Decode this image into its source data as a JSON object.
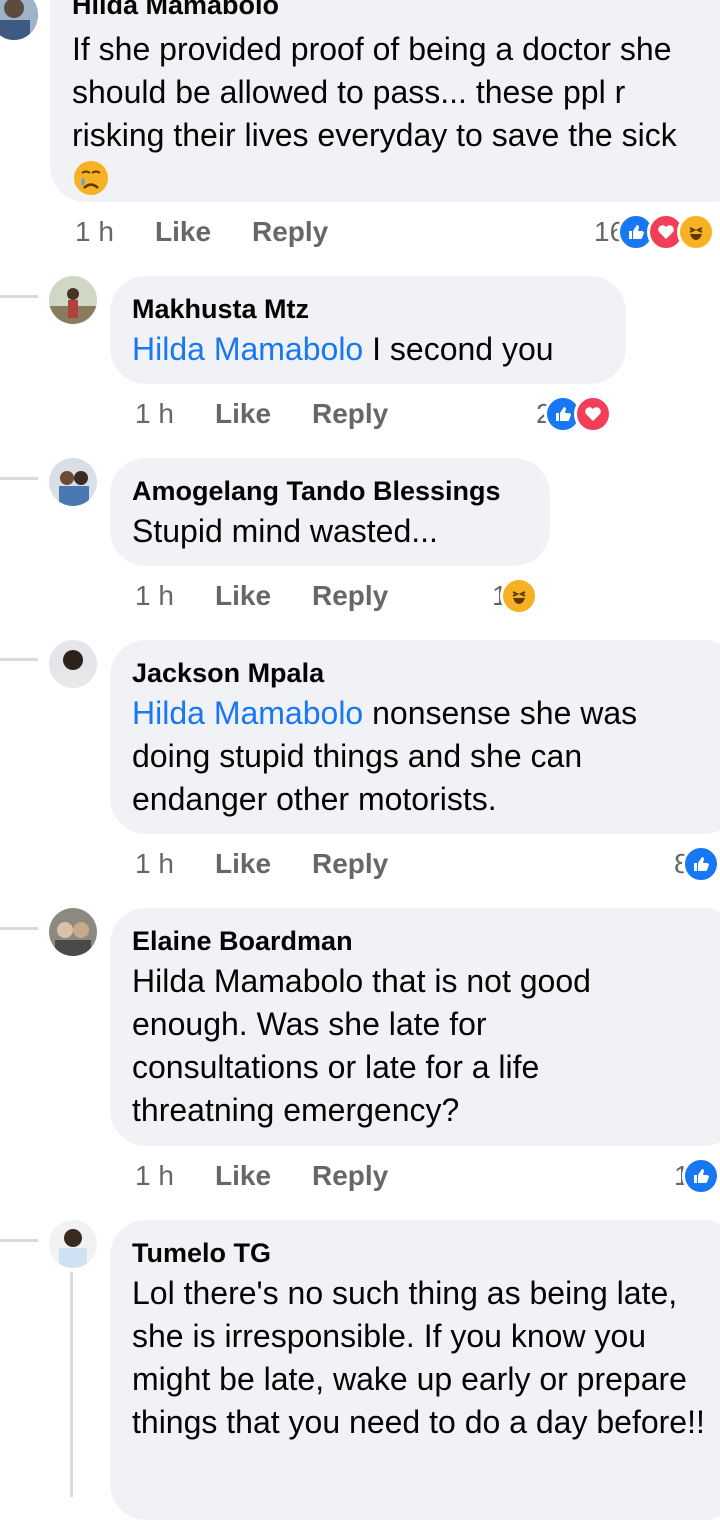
{
  "colors": {
    "link": "#1877f2",
    "bubble": "#f0f2f5",
    "meta": "#65676b",
    "like": "#1877f2",
    "love": "#f33e58",
    "haha": "#f7b125"
  },
  "top_comment": {
    "author": "Hilda Mamabolo",
    "text": "If she provided proof of being a doctor she should be allowed to pass... these ppl r risking their lives everyday to save the sick",
    "emoji": "crying-face-icon",
    "time": "1 h",
    "like": "Like",
    "reply": "Reply",
    "reaction_count": "16",
    "reactions": [
      "like-icon",
      "love-icon",
      "haha-icon"
    ]
  },
  "replies": [
    {
      "author": "Makhusta Mtz",
      "mention": "Hilda Mamabolo",
      "text": " I second you",
      "time": "1 h",
      "like": "Like",
      "reply": "Reply",
      "reaction_count": "2",
      "reactions": [
        "like-icon",
        "love-icon"
      ]
    },
    {
      "author": "Amogelang Tando Blessings",
      "mention": "",
      "text": "Stupid mind wasted...",
      "time": "1 h",
      "like": "Like",
      "reply": "Reply",
      "reaction_count": "1",
      "reactions": [
        "haha-icon"
      ]
    },
    {
      "author": "Jackson Mpala",
      "mention": "Hilda Mamabolo",
      "text": " nonsense she was doing stupid things and she can endanger other motorists.",
      "time": "1 h",
      "like": "Like",
      "reply": "Reply",
      "reaction_count": "8",
      "reactions": [
        "like-icon"
      ]
    },
    {
      "author": "Elaine Boardman",
      "mention": "",
      "text": "Hilda Mamabolo that is not good enough. Was she late for consultations or late for a life threatning emergency?",
      "time": "1 h",
      "like": "Like",
      "reply": "Reply",
      "reaction_count": "1",
      "reactions": [
        "like-icon"
      ]
    },
    {
      "author": "Tumelo TG",
      "mention": "",
      "text": "Lol there's no such thing as being late, she is irresponsible. If you know you might be late, wake up early or prepare things that you need to do a day before!!"
    }
  ]
}
